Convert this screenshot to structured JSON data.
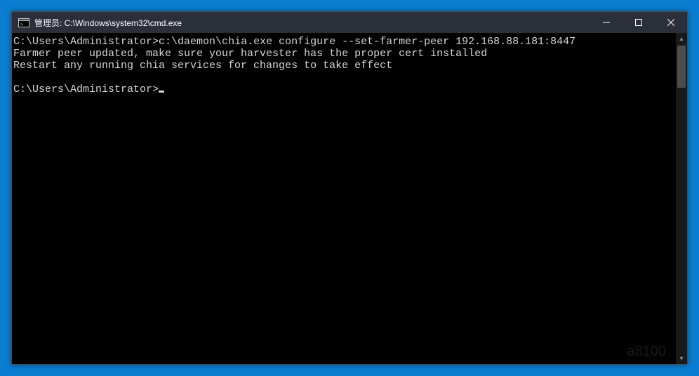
{
  "window": {
    "title": "管理员: C:\\Windows\\system32\\cmd.exe"
  },
  "terminal": {
    "lines": [
      {
        "prompt": "C:\\Users\\Administrator>",
        "command": "c:\\daemon\\chia.exe configure --set-farmer-peer 192.168.88.181:8447"
      },
      {
        "text": "Farmer peer updated, make sure your harvester has the proper cert installed"
      },
      {
        "text": "Restart any running chia services for changes to take effect"
      },
      {
        "text": ""
      },
      {
        "prompt": "C:\\Users\\Administrator>",
        "cursor": true
      }
    ]
  },
  "watermark": "a8100"
}
